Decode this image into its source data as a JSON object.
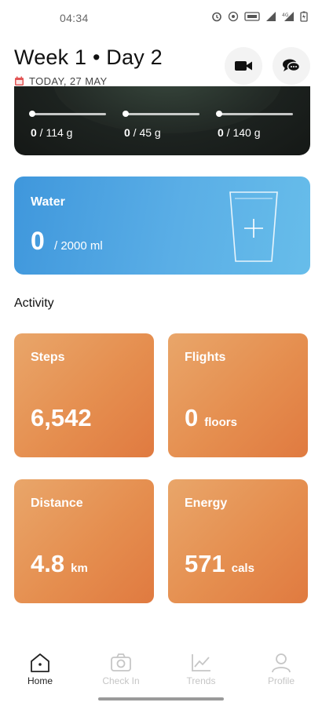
{
  "status_bar": {
    "time": "04:34"
  },
  "header": {
    "title": "Week 1 • Day 2",
    "date": "TODAY, 27 MAY",
    "video_button_icon": "video-camera-icon",
    "chat_button_icon": "chat-bubbles-icon"
  },
  "macros": [
    {
      "current": "0",
      "target": " / 114 g"
    },
    {
      "current": "0",
      "target": " / 45 g"
    },
    {
      "current": "0",
      "target": " / 140 g"
    }
  ],
  "water": {
    "label": "Water",
    "value": "0",
    "goal": "/ 2000 ml",
    "add_icon": "add-water-cup-icon"
  },
  "activity": {
    "title": "Activity",
    "tiles": [
      {
        "label": "Steps",
        "value": "6,542",
        "unit": ""
      },
      {
        "label": "Flights",
        "value": "0",
        "unit": "floors"
      },
      {
        "label": "Distance",
        "value": "4.8",
        "unit": "km"
      },
      {
        "label": "Energy",
        "value": "571",
        "unit": "cals"
      }
    ]
  },
  "nav": {
    "items": [
      {
        "label": "Home",
        "icon": "home-icon",
        "active": true
      },
      {
        "label": "Check In",
        "icon": "camera-icon",
        "active": false
      },
      {
        "label": "Trends",
        "icon": "chart-line-icon",
        "active": false
      },
      {
        "label": "Profile",
        "icon": "profile-icon",
        "active": false
      }
    ]
  },
  "colors": {
    "accent_water": "#4aa3e2",
    "accent_activity": "#e58e4f",
    "calendar_icon": "#e25555"
  }
}
